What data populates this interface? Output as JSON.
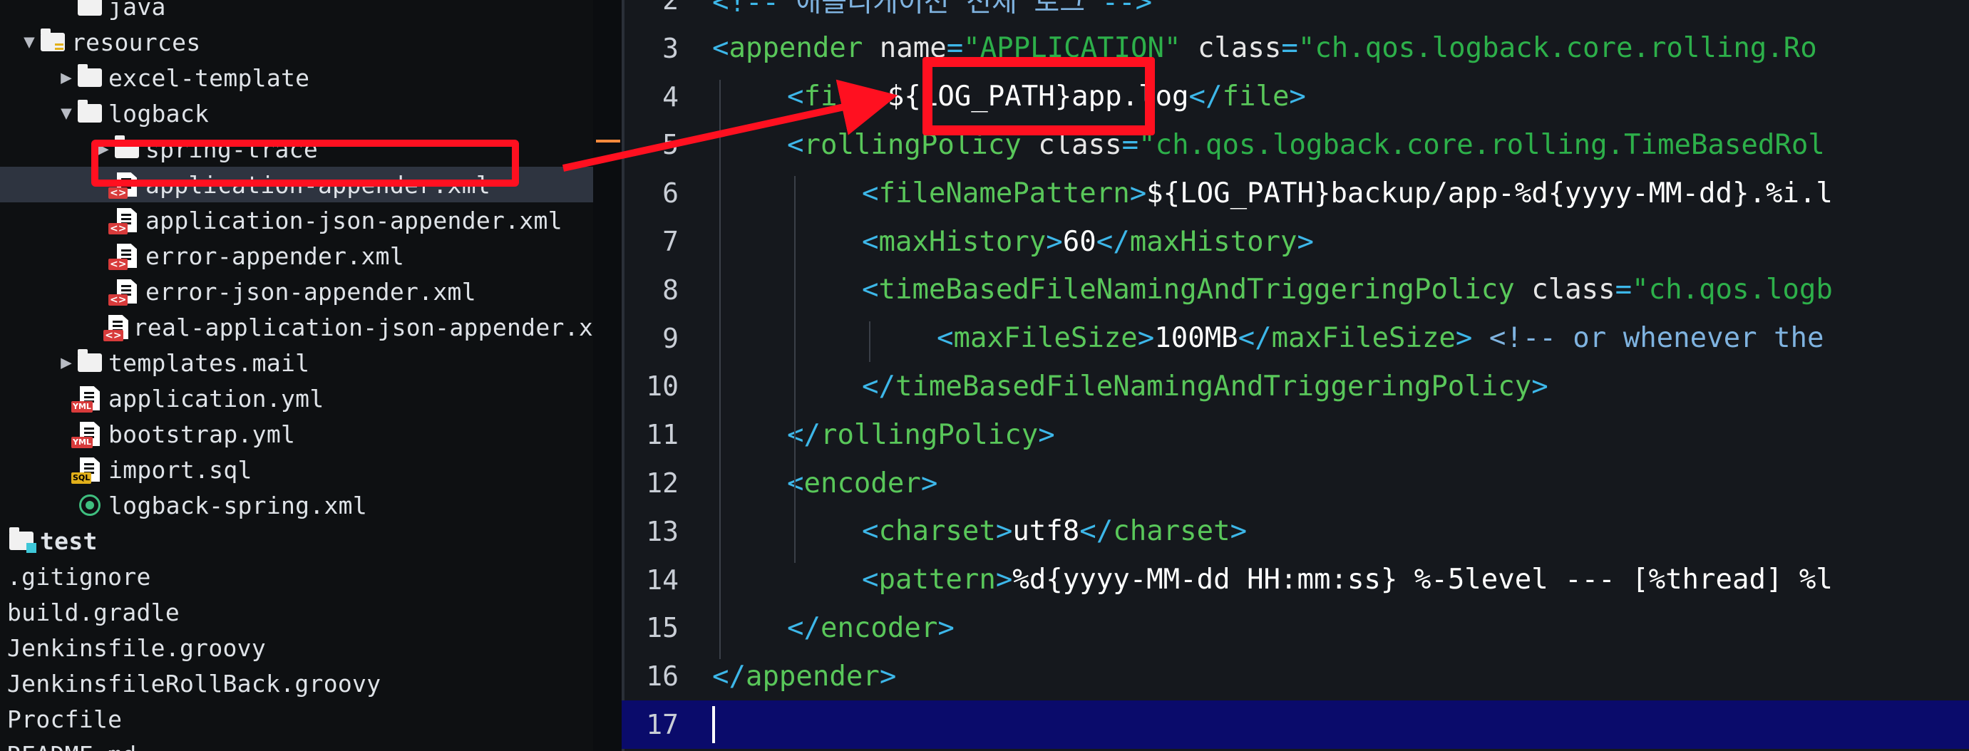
{
  "tree": {
    "items": [
      {
        "label": "java",
        "indent": 1,
        "icon": "folder-icon",
        "arrow": ""
      },
      {
        "label": "resources",
        "indent": 0,
        "icon": "resources-folder-icon",
        "arrow": "▼"
      },
      {
        "label": "excel-template",
        "indent": 1,
        "icon": "folder-icon",
        "arrow": "▶"
      },
      {
        "label": "logback",
        "indent": 1,
        "icon": "folder-icon",
        "arrow": "▼"
      },
      {
        "label": "spring-trace",
        "indent": 2,
        "icon": "folder-icon",
        "arrow": "▶"
      },
      {
        "label": "application-appender.xml",
        "indent": 2,
        "icon": "xml-file-icon",
        "arrow": ""
      },
      {
        "label": "application-json-appender.xml",
        "indent": 2,
        "icon": "xml-file-icon",
        "arrow": ""
      },
      {
        "label": "error-appender.xml",
        "indent": 2,
        "icon": "xml-file-icon",
        "arrow": ""
      },
      {
        "label": "error-json-appender.xml",
        "indent": 2,
        "icon": "xml-file-icon",
        "arrow": ""
      },
      {
        "label": "real-application-json-appender.x",
        "indent": 2,
        "icon": "xml-file-icon",
        "arrow": ""
      },
      {
        "label": "templates.mail",
        "indent": 1,
        "icon": "folder-icon",
        "arrow": "▶"
      },
      {
        "label": "application.yml",
        "indent": 1,
        "icon": "yml-file-icon",
        "arrow": ""
      },
      {
        "label": "bootstrap.yml",
        "indent": 1,
        "icon": "yml-file-icon",
        "arrow": ""
      },
      {
        "label": "import.sql",
        "indent": 1,
        "icon": "sql-file-icon",
        "arrow": ""
      },
      {
        "label": "logback-spring.xml",
        "indent": 1,
        "icon": "spring-config-icon",
        "arrow": ""
      },
      {
        "label": "test",
        "indent": -1,
        "icon": "test-folder-icon",
        "arrow": ""
      },
      {
        "label": ".gitignore",
        "indent": -2,
        "icon": "",
        "arrow": ""
      },
      {
        "label": "build.gradle",
        "indent": -2,
        "icon": "",
        "arrow": ""
      },
      {
        "label": "Jenkinsfile.groovy",
        "indent": -2,
        "icon": "",
        "arrow": ""
      },
      {
        "label": "JenkinsfileRollBack.groovy",
        "indent": -2,
        "icon": "",
        "arrow": ""
      },
      {
        "label": "Procfile",
        "indent": -2,
        "icon": "",
        "arrow": ""
      },
      {
        "label": "README.md",
        "indent": -2,
        "icon": "",
        "arrow": ""
      }
    ],
    "selected_index": 5,
    "badges": {
      "xml": "<>",
      "yml": "YML",
      "sql": "SQL"
    }
  },
  "editor": {
    "current_line": 17,
    "lines": [
      {
        "n": "2",
        "parts": [
          [
            "t",
            "<!-- "
          ],
          [
            "cmt",
            "애플리케이션 전체 로그 "
          ],
          [
            "t",
            "-->"
          ]
        ],
        "indent": 0
      },
      {
        "n": "3",
        "parts": [
          [
            "t",
            "<"
          ],
          [
            "tag",
            "appender"
          ],
          [
            "attr",
            " name"
          ],
          [
            "eq",
            "="
          ],
          [
            "str",
            "\"APPLICATION\""
          ],
          [
            "attr",
            " class"
          ],
          [
            "eq",
            "="
          ],
          [
            "str",
            "\"ch.qos.logback.core.rolling.Ro"
          ]
        ],
        "indent": 0
      },
      {
        "n": "4",
        "parts": [
          [
            "t",
            "<"
          ],
          [
            "tag",
            "file"
          ],
          [
            "t",
            ">"
          ],
          [
            "txt",
            "${LOG_PATH}app.log"
          ],
          [
            "t",
            "</"
          ],
          [
            "tag",
            "file"
          ],
          [
            "t",
            ">"
          ]
        ],
        "indent": 1
      },
      {
        "n": "5",
        "parts": [
          [
            "t",
            "<"
          ],
          [
            "tag",
            "rollingPolicy"
          ],
          [
            "attr",
            " class"
          ],
          [
            "eq",
            "="
          ],
          [
            "str",
            "\"ch.qos.logback.core.rolling.TimeBasedRol"
          ]
        ],
        "indent": 1
      },
      {
        "n": "6",
        "parts": [
          [
            "t",
            "<"
          ],
          [
            "tag",
            "fileNamePattern"
          ],
          [
            "t",
            ">"
          ],
          [
            "txt",
            "${LOG_PATH}backup/app-%d{yyyy-MM-dd}.%i.l"
          ]
        ],
        "indent": 2
      },
      {
        "n": "7",
        "parts": [
          [
            "t",
            "<"
          ],
          [
            "tag",
            "maxHistory"
          ],
          [
            "t",
            ">"
          ],
          [
            "txt",
            "60"
          ],
          [
            "t",
            "</"
          ],
          [
            "tag",
            "maxHistory"
          ],
          [
            "t",
            ">"
          ]
        ],
        "indent": 2
      },
      {
        "n": "8",
        "parts": [
          [
            "t",
            "<"
          ],
          [
            "tag",
            "timeBasedFileNamingAndTriggeringPolicy"
          ],
          [
            "attr",
            " class"
          ],
          [
            "eq",
            "="
          ],
          [
            "str",
            "\"ch.qos.logb"
          ]
        ],
        "indent": 2
      },
      {
        "n": "9",
        "parts": [
          [
            "t",
            "<"
          ],
          [
            "tag",
            "maxFileSize"
          ],
          [
            "t",
            ">"
          ],
          [
            "txt",
            "100MB"
          ],
          [
            "t",
            "</"
          ],
          [
            "tag",
            "maxFileSize"
          ],
          [
            "t",
            "> "
          ],
          [
            "cmt",
            "<!-- or whenever the"
          ]
        ],
        "indent": 3
      },
      {
        "n": "10",
        "parts": [
          [
            "t",
            "</"
          ],
          [
            "tag",
            "timeBasedFileNamingAndTriggeringPolicy"
          ],
          [
            "t",
            ">"
          ]
        ],
        "indent": 2
      },
      {
        "n": "11",
        "parts": [
          [
            "t",
            "</"
          ],
          [
            "tag",
            "rollingPolicy"
          ],
          [
            "t",
            ">"
          ]
        ],
        "indent": 1
      },
      {
        "n": "12",
        "parts": [
          [
            "t",
            "<"
          ],
          [
            "tag",
            "encoder"
          ],
          [
            "t",
            ">"
          ]
        ],
        "indent": 1
      },
      {
        "n": "13",
        "parts": [
          [
            "t",
            "<"
          ],
          [
            "tag",
            "charset"
          ],
          [
            "t",
            ">"
          ],
          [
            "txt",
            "utf8"
          ],
          [
            "t",
            "</"
          ],
          [
            "tag",
            "charset"
          ],
          [
            "t",
            ">"
          ]
        ],
        "indent": 2
      },
      {
        "n": "14",
        "parts": [
          [
            "t",
            "<"
          ],
          [
            "tag",
            "pattern"
          ],
          [
            "t",
            ">"
          ],
          [
            "txt",
            "%d{yyyy-MM-dd HH:mm:ss} %-5level --- [%thread] %l"
          ]
        ],
        "indent": 2
      },
      {
        "n": "15",
        "parts": [
          [
            "t",
            "</"
          ],
          [
            "tag",
            "encoder"
          ],
          [
            "t",
            ">"
          ]
        ],
        "indent": 1
      },
      {
        "n": "16",
        "parts": [
          [
            "t",
            "</"
          ],
          [
            "tag",
            "appender"
          ],
          [
            "t",
            ">"
          ]
        ],
        "indent": 0
      },
      {
        "n": "17",
        "parts": [],
        "indent": 0
      }
    ]
  },
  "colors": {
    "highlight": "#ff1020",
    "tag": "#59c75a",
    "bracket": "#3db7e9",
    "string": "#2db04a",
    "current_line": "#0a0b6b"
  }
}
